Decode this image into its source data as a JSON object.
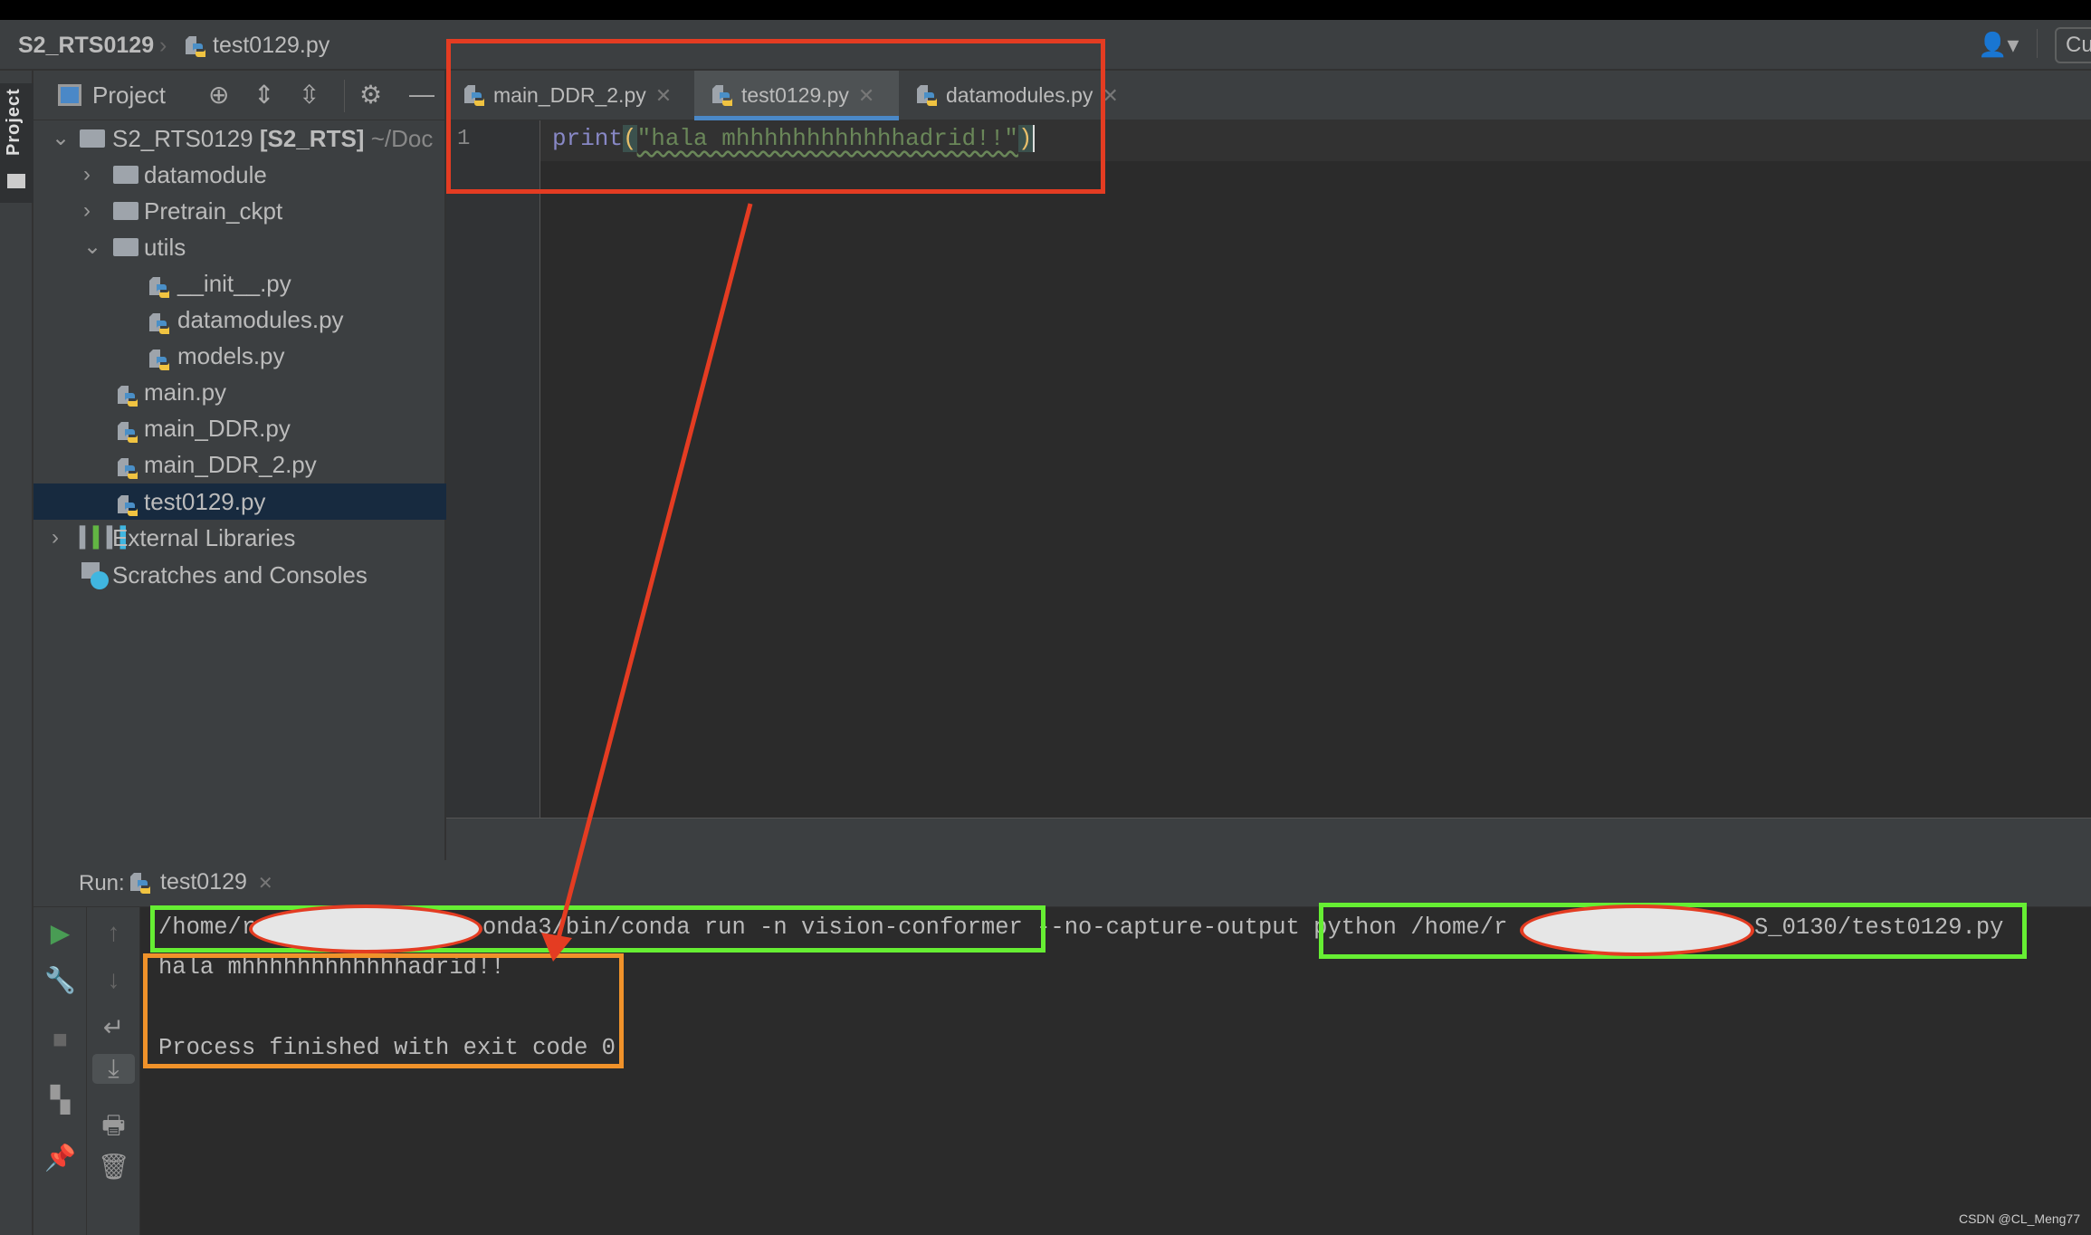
{
  "breadcrumb": {
    "project": "S2_RTS0129",
    "file": "test0129.py"
  },
  "topright": {
    "user_icon": "user-icon",
    "button_label": "Cu"
  },
  "sidebar_stripe": {
    "label": "Project"
  },
  "project_panel": {
    "title": "Project",
    "root": {
      "name": "S2_RTS0129",
      "module": "[S2_RTS]",
      "path": "~/Doc"
    },
    "items": [
      {
        "label": "datamodule",
        "type": "folder"
      },
      {
        "label": "Pretrain_ckpt",
        "type": "folder"
      },
      {
        "label": "utils",
        "type": "folder"
      },
      {
        "label": "__init__.py",
        "type": "python"
      },
      {
        "label": "datamodules.py",
        "type": "python"
      },
      {
        "label": "models.py",
        "type": "python"
      },
      {
        "label": "main.py",
        "type": "python"
      },
      {
        "label": "main_DDR.py",
        "type": "python"
      },
      {
        "label": "main_DDR_2.py",
        "type": "python"
      },
      {
        "label": "test0129.py",
        "type": "python",
        "selected": true
      },
      {
        "label": "External Libraries",
        "type": "library"
      },
      {
        "label": "Scratches and Consoles",
        "type": "scratches"
      }
    ]
  },
  "editor": {
    "tabs": [
      {
        "label": "main_DDR_2.py"
      },
      {
        "label": "test0129.py",
        "active": true
      },
      {
        "label": "datamodules.py"
      }
    ],
    "line_number": "1",
    "code": {
      "func": "print",
      "open": "(",
      "string": "\"hala mhhhhhhhhhhhhadrid!!\"",
      "close": ")"
    }
  },
  "run": {
    "label": "Run:",
    "tab": "test0129",
    "console": {
      "cmd_part1": "/home/r",
      "cmd_part2": "onda3/bin/conda run -n vision-conformer --no-capture-output python /home/r",
      "cmd_part3": "S_0130/test0129.py",
      "output": "hala mhhhhhhhhhhhhadrid!!",
      "exit": "Process finished with exit code 0"
    }
  },
  "colors": {
    "accent": "#4a88c7",
    "annotation_red": "#e43c22",
    "annotation_green": "#66ee33",
    "annotation_orange": "#f0922a",
    "run_green": "#499c54"
  },
  "watermark": "CSDN @CL_Meng77"
}
